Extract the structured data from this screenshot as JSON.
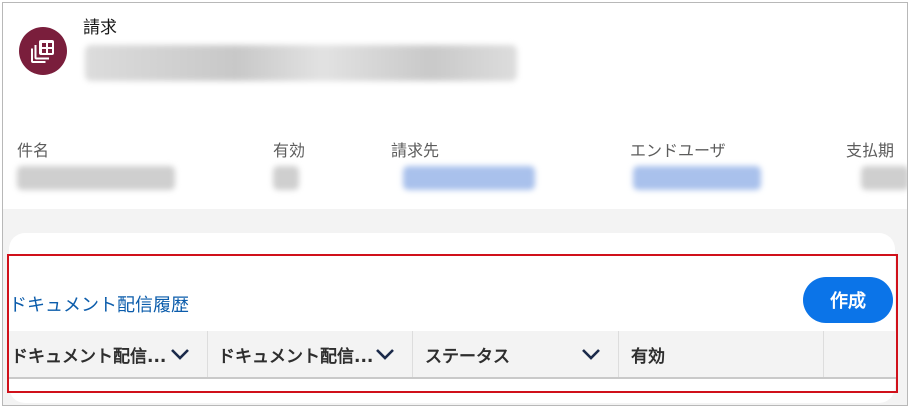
{
  "record": {
    "object_type": "請求",
    "icon": "stacked-cards-icon",
    "icon_color": "#7a1e3c"
  },
  "highlights": [
    {
      "label": "件名",
      "value_style": "gray"
    },
    {
      "label": "有効",
      "value_style": "gray"
    },
    {
      "label": "請求先",
      "value_style": "blue"
    },
    {
      "label": "エンドユーザ",
      "value_style": "blue"
    },
    {
      "label": "支払期",
      "value_style": "gray"
    }
  ],
  "related_list": {
    "title": "ドキュメント配信履歴",
    "create_button_label": "作成",
    "columns": [
      {
        "label": "ドキュメント配信...",
        "sortable_icon": "chevron-down-icon"
      },
      {
        "label": "ドキュメント配信...",
        "sortable_icon": "chevron-down-icon"
      },
      {
        "label": "ステータス",
        "sortable_icon": "chevron-down-icon"
      },
      {
        "label": "有効",
        "sortable_icon": ""
      }
    ]
  },
  "colors": {
    "link_blue": "#0b5cab",
    "button_blue": "#0b74e8",
    "highlight_red": "#d0101a"
  }
}
